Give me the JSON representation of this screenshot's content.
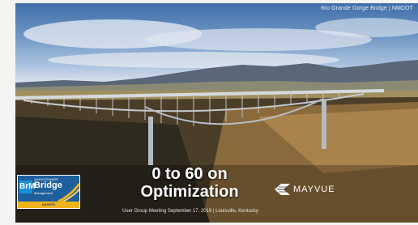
{
  "photo_credit": "Rio Grande Gorge Bridge | NMDOT",
  "title_line1": "0 to 60 on",
  "title_line2": "Optimization",
  "subtitle": "User Group Meeting September 17, 2019 | Louisville, Kentucky",
  "brm_logo": {
    "badge": "BrM",
    "small_label": "AASHTOWARE",
    "main": "Bridge",
    "sub": "Management",
    "bar": "AASHTO"
  },
  "mayvue_logo": "MAYVUE",
  "colors": {
    "brm_blue": "#1e5f9e",
    "brm_gold": "#f0b21c",
    "title_white": "#ffffff"
  }
}
